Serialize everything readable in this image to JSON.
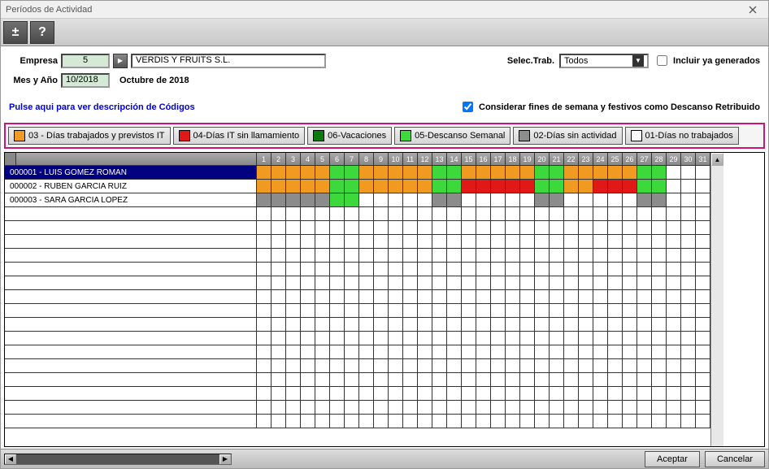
{
  "window": {
    "title": "Períodos de Actividad"
  },
  "toolbar": {
    "plus": "±",
    "help": "?"
  },
  "form": {
    "empresa_label": "Empresa",
    "empresa_num": "5",
    "empresa_name": "VERDIS Y FRUITS S.L.",
    "mesano_label": "Mes y Año",
    "mesano_value": "10/2018",
    "mesano_text": "Octubre de 2018",
    "sel_trab_label": "Selec.Trab.",
    "sel_trab_value": "Todos",
    "incluir_label": "Incluir ya generados",
    "link_text": "Pulse aqui para ver descripción de Códigos",
    "considerar_label": "Considerar fines de semana y festivos como Descanso Retribuido"
  },
  "legend": [
    {
      "color": "#F19A22",
      "label": "03 - Días trabajados y previstos IT"
    },
    {
      "color": "#E01818",
      "label": "04-Días IT sin llamamiento"
    },
    {
      "color": "#0C7A0C",
      "label": "06-Vacaciones"
    },
    {
      "color": "#3CD83C",
      "label": "05-Descanso Semanal"
    },
    {
      "color": "#8C8C8C",
      "label": "02-Días sin actividad"
    },
    {
      "color": "#FFFFFF",
      "label": "01-Días no trabajados"
    }
  ],
  "chart_data": {
    "type": "heatmap",
    "days": 31,
    "colors": {
      "03": "#F19A22",
      "04": "#E01818",
      "06": "#0C7A0C",
      "05": "#3CD83C",
      "02": "#8C8C8C",
      "01": "#FFFFFF",
      "": "#FFFFFF"
    },
    "rows": [
      {
        "id": "000001",
        "name": "LUIS GOMEZ ROMAN",
        "selected": true,
        "cells": [
          "03",
          "03",
          "03",
          "03",
          "03",
          "05",
          "05",
          "03",
          "03",
          "03",
          "03",
          "03",
          "05",
          "05",
          "03",
          "03",
          "03",
          "03",
          "03",
          "05",
          "05",
          "03",
          "03",
          "03",
          "03",
          "03",
          "05",
          "05",
          "",
          "",
          ""
        ]
      },
      {
        "id": "000002",
        "name": "RUBEN GARCIA RUIZ",
        "selected": false,
        "cells": [
          "03",
          "03",
          "03",
          "03",
          "03",
          "05",
          "05",
          "03",
          "03",
          "03",
          "03",
          "03",
          "05",
          "05",
          "04",
          "04",
          "04",
          "04",
          "04",
          "05",
          "05",
          "03",
          "03",
          "04",
          "04",
          "04",
          "05",
          "05",
          "",
          "",
          ""
        ]
      },
      {
        "id": "000003",
        "name": "SARA GARCIA LOPEZ",
        "selected": false,
        "cells": [
          "02",
          "02",
          "02",
          "02",
          "02",
          "05",
          "05",
          "",
          "",
          "",
          "",
          "",
          "02",
          "02",
          "",
          "",
          "",
          "",
          "",
          "02",
          "02",
          "",
          "",
          "",
          "",
          "",
          "02",
          "02",
          "",
          "",
          ""
        ]
      }
    ],
    "blank_rows": 16
  },
  "buttons": {
    "accept": "Aceptar",
    "cancel": "Cancelar"
  }
}
